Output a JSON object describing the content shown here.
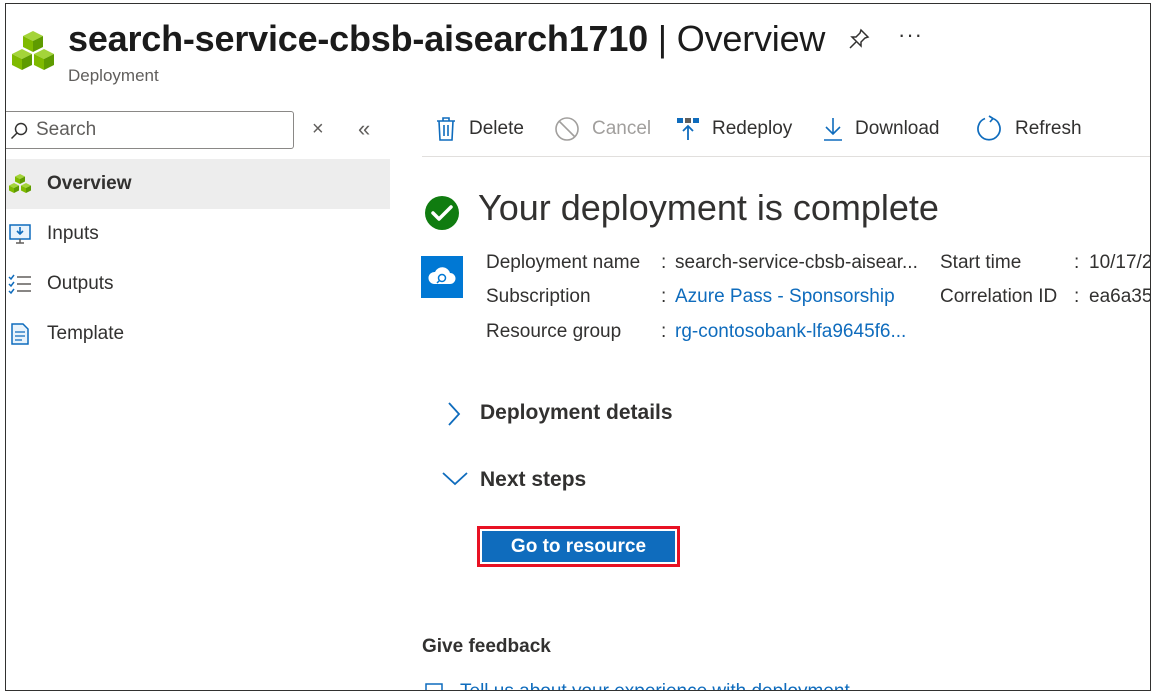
{
  "header": {
    "resource_name": "search-service-cbsb-aisearch1710",
    "separator": " | ",
    "page": "Overview",
    "subtitle": "Deployment",
    "more_label": "···"
  },
  "sidebar": {
    "search_placeholder": "Search",
    "close_glyph": "×",
    "collapse_glyph": "«",
    "items": [
      {
        "label": "Overview",
        "icon": "deployment-cubes-icon",
        "active": true
      },
      {
        "label": "Inputs",
        "icon": "inputs-icon"
      },
      {
        "label": "Outputs",
        "icon": "outputs-list-icon"
      },
      {
        "label": "Template",
        "icon": "template-document-icon"
      }
    ]
  },
  "toolbar": {
    "delete": "Delete",
    "cancel": "Cancel",
    "redeploy": "Redeploy",
    "download": "Download",
    "refresh": "Refresh"
  },
  "main": {
    "heading": "Your deployment is complete",
    "details": {
      "deployment_name_label": "Deployment name",
      "deployment_name_value": "search-service-cbsb-aisear...",
      "subscription_label": "Subscription",
      "subscription_value": "Azure Pass - Sponsorship",
      "resource_group_label": "Resource group",
      "resource_group_value": "rg-contosobank-lfa9645f6...",
      "start_time_label": "Start time",
      "start_time_value": "10/17/2",
      "correlation_id_label": "Correlation ID",
      "correlation_id_value": "ea6a35",
      "colon": ":"
    },
    "deployment_details_label": "Deployment details",
    "next_steps_label": "Next steps",
    "go_to_resource_label": "Go to resource",
    "give_feedback_label": "Give feedback",
    "tell_us_label": "Tell us about your experience with deployment"
  },
  "colors": {
    "accent": "#0f6cbd",
    "success": "#107c10",
    "highlight_border": "#e81123",
    "azure_green": "#7fba00"
  }
}
